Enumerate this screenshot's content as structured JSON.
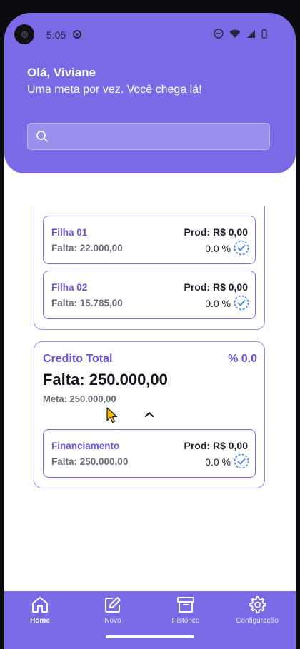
{
  "status_bar": {
    "time": "5:05"
  },
  "header": {
    "greeting": "Olá, Viviane",
    "motto": "Uma meta por vez. Você chega lá!",
    "search_value": "",
    "search_placeholder": ""
  },
  "goal_group_1": {
    "items": [
      {
        "name": "Filha 01",
        "falta": "Falta: 22.000,00",
        "prod": "Prod: R$ 0,00",
        "percent": "0.0 %"
      },
      {
        "name": "Filha 02",
        "falta": "Falta: 15.785,00",
        "prod": "Prod: R$ 0,00",
        "percent": "0.0 %"
      }
    ]
  },
  "goal_group_2": {
    "title": "Credito Total",
    "percent": "% 0.0",
    "falta": "Falta: 250.000,00",
    "meta": "Meta: 250.000,00",
    "items": [
      {
        "name": "Financiamento",
        "falta": "Falta: 250.000,00",
        "prod": "Prod: R$ 0,00",
        "percent": "0.0 %"
      }
    ]
  },
  "bottom_nav": {
    "items": [
      {
        "label": "Home",
        "icon": "home-icon",
        "active": true
      },
      {
        "label": "Novo",
        "icon": "edit-icon",
        "active": false
      },
      {
        "label": "Histórico",
        "icon": "archive-icon",
        "active": false
      },
      {
        "label": "Configuração",
        "icon": "gear-icon",
        "active": false
      }
    ]
  },
  "colors": {
    "primary": "#7a6ae6",
    "accent_text": "#6a55d8",
    "muted_text": "#6b6b78",
    "check_blue": "#3b82f6"
  }
}
